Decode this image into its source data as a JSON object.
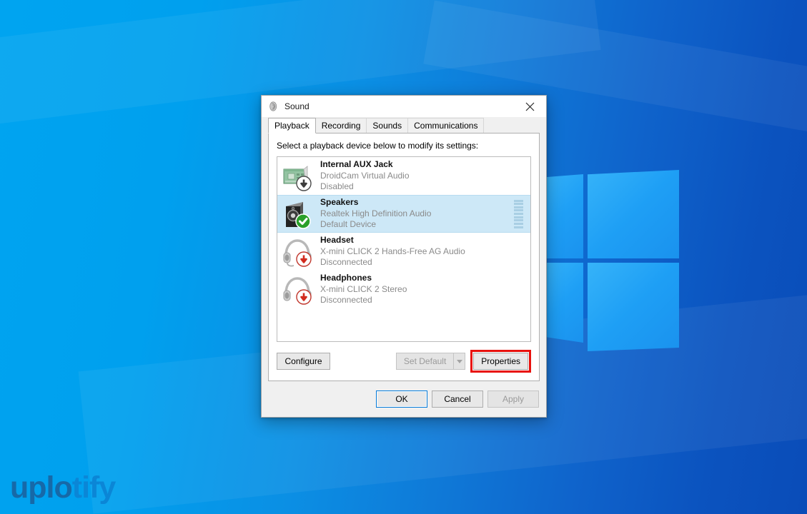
{
  "desktop": {
    "wallpaper_accent": "#0f7ad8",
    "watermark": {
      "part_a": "uplo",
      "part_b": "tify",
      "color_a": "#1669a8",
      "color_b": "#0b86d6"
    },
    "logo": {
      "name": "windows-logo"
    }
  },
  "dialog": {
    "title": "Sound",
    "title_icon": "sound-icon",
    "close_label": "Close",
    "tabs": [
      {
        "label": "Playback",
        "active": true
      },
      {
        "label": "Recording",
        "active": false
      },
      {
        "label": "Sounds",
        "active": false
      },
      {
        "label": "Communications",
        "active": false
      }
    ],
    "instruction": "Select a playback device below to modify its settings:",
    "devices": [
      {
        "name": "Internal AUX Jack",
        "description": "DroidCam Virtual Audio",
        "state": "Disabled",
        "icon": "sound-card-icon",
        "badge": "disabled-arrow-badge",
        "selected": false,
        "has_meter": false
      },
      {
        "name": "Speakers",
        "description": "Realtek High Definition Audio",
        "state": "Default Device",
        "icon": "speaker-icon",
        "badge": "default-check-badge",
        "selected": true,
        "has_meter": true,
        "meter_segments": 9
      },
      {
        "name": "Headset",
        "description": "X-mini CLICK 2 Hands-Free AG Audio",
        "state": "Disconnected",
        "icon": "headset-icon",
        "badge": "disconnected-arrow-badge",
        "selected": false,
        "has_meter": false
      },
      {
        "name": "Headphones",
        "description": "X-mini CLICK 2 Stereo",
        "state": "Disconnected",
        "icon": "headphones-icon",
        "badge": "disconnected-arrow-badge",
        "selected": false,
        "has_meter": false
      }
    ],
    "actions": {
      "configure": "Configure",
      "set_default": "Set Default",
      "set_default_disabled": true,
      "properties": "Properties",
      "properties_highlight_color": "#e8120e"
    },
    "footer": {
      "ok": "OK",
      "cancel": "Cancel",
      "apply": "Apply",
      "apply_disabled": true,
      "ok_focused": true
    }
  }
}
